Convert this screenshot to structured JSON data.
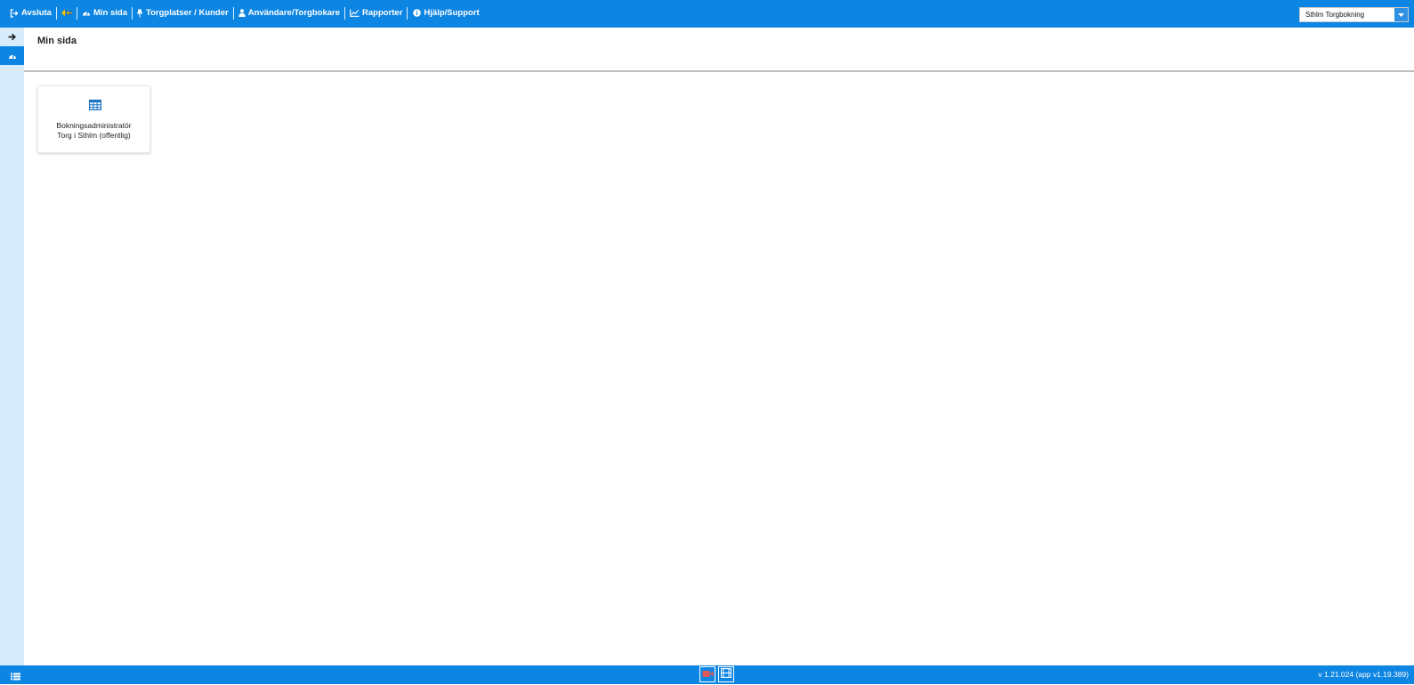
{
  "topbar": {
    "nav": [
      {
        "label": "Avsluta",
        "icon": "sign-out-icon"
      },
      {
        "label": "",
        "icon": "swedish-flag-back-icon"
      },
      {
        "label": "Min sida",
        "icon": "dashboard-icon"
      },
      {
        "label": "Torgplatser / Kunder",
        "icon": "thumbtack-icon"
      },
      {
        "label": "Användare/Torgbokare",
        "icon": "user-icon"
      },
      {
        "label": "Rapporter",
        "icon": "line-chart-icon"
      },
      {
        "label": "Hjälp/Support",
        "icon": "info-circle-icon"
      }
    ],
    "org_select": {
      "value": "Sthlm Torgbokning"
    }
  },
  "sidebar": {
    "toggle_icon": "arrow-right-icon",
    "active_icon": "dashboard-icon"
  },
  "main": {
    "title": "Min sida",
    "tiles": [
      {
        "line1": "Bokningsadministratör",
        "line2": "Torg i Sthlm (offentlig)",
        "icon": "table-icon"
      }
    ]
  },
  "footer": {
    "menu_icon": "list-icon",
    "buttons": [
      {
        "icon": "video-camera-icon"
      },
      {
        "icon": "film-icon"
      }
    ],
    "version": "v 1.21.024 (app v1.19.389)"
  },
  "colors": {
    "brand_blue": "#0d85e3",
    "sidebar_bg": "#d9ecfb",
    "tile_icon": "#1a73c7"
  }
}
